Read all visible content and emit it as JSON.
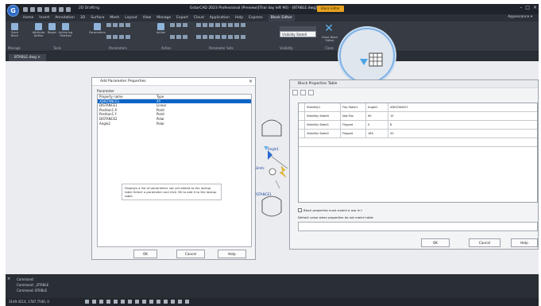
{
  "window": {
    "app_title": "GstarCAD 2023 Professional (Preview)[Trial day left 90] - [BTABLE.dwg]",
    "workspace": "2D Drafting",
    "tour_button": "Block Editor",
    "notice_button": "Block Editor",
    "appearance": "Appearance ▾"
  },
  "menu": [
    "Home",
    "Insert",
    "Annotation",
    "3D",
    "Surface",
    "Mesh",
    "Layout",
    "View",
    "Manage",
    "Export",
    "Cloud",
    "Application",
    "Help",
    "Express",
    "Block Editor"
  ],
  "ribbon": {
    "buttons": [
      "Save Block",
      "Attribute Define",
      "Regen",
      "Authoring Palettes",
      "Parameters",
      "Action"
    ],
    "visibility_state": "Visibility State0",
    "groups": [
      "Manage",
      "Tools",
      "Parameters",
      "Action",
      "Parameter Sets",
      "Visibility",
      "Close"
    ],
    "close_label": "Close Block Editor"
  },
  "doc_tab": "BTABLE.dwg",
  "add_param_dialog": {
    "title": "Add Parameter Properties",
    "section": "Parameter",
    "headers": [
      "Property name",
      "Type"
    ],
    "rows": [
      {
        "name": "XDISTANCE1",
        "type": "XY"
      },
      {
        "name": "DISTANCE1",
        "type": "Linear"
      },
      {
        "name": "Position1 X",
        "type": "Point"
      },
      {
        "name": "Position1 Y",
        "type": "Point"
      },
      {
        "name": "DISTANCE2",
        "type": "Polar"
      },
      {
        "name": "Angle2",
        "type": "Polar"
      }
    ],
    "hint": "Displays a list of parameters not yet added to the lookup table Select a parameter and click OK to add it to the lookup table.",
    "ok": "OK",
    "cancel": "Cancel",
    "help": "Help"
  },
  "block_props_dialog": {
    "title": "Block Properties Table",
    "headers": [
      "Visibility1",
      "Flip State1",
      "Angle1",
      "XDISTANCE1"
    ],
    "rows": [
      [
        "Visibility State0",
        "Not Flip",
        "90",
        "15"
      ],
      [
        "Visibility State1",
        "Flipped",
        "0",
        "8"
      ],
      [
        "Visibility State2",
        "Flipped",
        "180",
        "20"
      ]
    ],
    "check_label": "Block properties must match a row in t",
    "default_label": "Default value when properties do not match table",
    "ok": "OK",
    "cancel": "Cancel",
    "help": "Help"
  },
  "canvas": {
    "angle_label": "Angle1",
    "stretch_label": "Stretc",
    "distance_label": "DISTANCE1"
  },
  "command": {
    "lines": [
      "Command:",
      "Command: _BTABLE",
      "Command: BTABLE"
    ],
    "coords": "3149.4214, 1787.7546, 0"
  },
  "colors": {
    "accent": "#0a64c8",
    "orange": "#e8a21f",
    "dark": "#2c3038"
  }
}
